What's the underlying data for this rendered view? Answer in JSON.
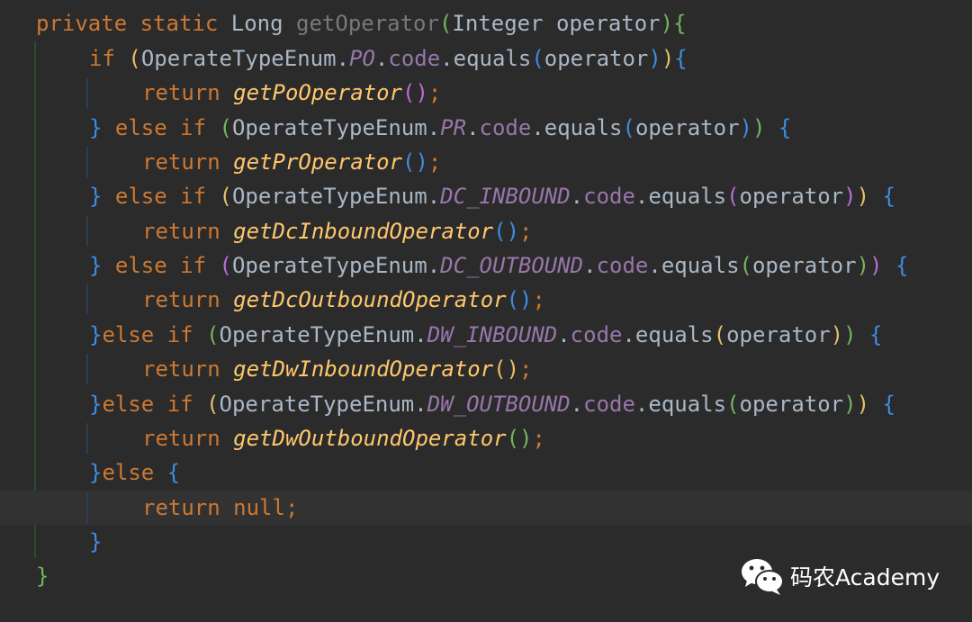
{
  "editor": {
    "theme_colors": {
      "background": "#2b2b2b",
      "current_line": "#323232",
      "keyword": "#cc7832",
      "method_declaration": "#787878",
      "identifier": "#a9b7c6",
      "static_field": "#9876aa",
      "method_call": "#ffc66d",
      "bracket_green": "#73b55e",
      "bracket_yellow": "#e8bf6a",
      "bracket_blue": "#3d8de0",
      "bracket_purple": "#b96bd6"
    },
    "current_line_index": 14,
    "lines": [
      {
        "tokens": [
          {
            "t": "private",
            "c": "kw"
          },
          {
            "t": " ",
            "c": "pun"
          },
          {
            "t": "static",
            "c": "kw"
          },
          {
            "t": " ",
            "c": "pun"
          },
          {
            "t": "Long",
            "c": "type"
          },
          {
            "t": " ",
            "c": "pun"
          },
          {
            "t": "getOperator",
            "c": "dim"
          },
          {
            "t": "(",
            "c": "b0"
          },
          {
            "t": "Integer",
            "c": "type"
          },
          {
            "t": " ",
            "c": "pun"
          },
          {
            "t": "operator",
            "c": "var"
          },
          {
            "t": ")",
            "c": "b0"
          },
          {
            "t": "{",
            "c": "b0"
          }
        ]
      },
      {
        "tokens": [
          {
            "t": "if",
            "c": "kw"
          },
          {
            "t": " ",
            "c": "pun"
          },
          {
            "t": "(",
            "c": "b1"
          },
          {
            "t": "OperateTypeEnum",
            "c": "type"
          },
          {
            "t": ".",
            "c": "pun"
          },
          {
            "t": "PO",
            "c": "fld"
          },
          {
            "t": ".",
            "c": "pun"
          },
          {
            "t": "code",
            "c": "prop"
          },
          {
            "t": ".",
            "c": "pun"
          },
          {
            "t": "equals",
            "c": "var"
          },
          {
            "t": "(",
            "c": "b2"
          },
          {
            "t": "operator",
            "c": "var"
          },
          {
            "t": ")",
            "c": "b2"
          },
          {
            "t": ")",
            "c": "b1"
          },
          {
            "t": "{",
            "c": "b2"
          }
        ]
      },
      {
        "tokens": [
          {
            "t": "return",
            "c": "kw"
          },
          {
            "t": " ",
            "c": "pun"
          },
          {
            "t": "getPoOperator",
            "c": "call"
          },
          {
            "t": "(",
            "c": "b3"
          },
          {
            "t": ")",
            "c": "b3"
          },
          {
            "t": ";",
            "c": "kw"
          }
        ]
      },
      {
        "tokens": [
          {
            "t": "}",
            "c": "b2"
          },
          {
            "t": " ",
            "c": "pun"
          },
          {
            "t": "else",
            "c": "kw"
          },
          {
            "t": " ",
            "c": "pun"
          },
          {
            "t": "if",
            "c": "kw"
          },
          {
            "t": " ",
            "c": "pun"
          },
          {
            "t": "(",
            "c": "b0"
          },
          {
            "t": "OperateTypeEnum",
            "c": "type"
          },
          {
            "t": ".",
            "c": "pun"
          },
          {
            "t": "PR",
            "c": "fld"
          },
          {
            "t": ".",
            "c": "pun"
          },
          {
            "t": "code",
            "c": "prop"
          },
          {
            "t": ".",
            "c": "pun"
          },
          {
            "t": "equals",
            "c": "var"
          },
          {
            "t": "(",
            "c": "b2"
          },
          {
            "t": "operator",
            "c": "var"
          },
          {
            "t": ")",
            "c": "b2"
          },
          {
            "t": ")",
            "c": "b0"
          },
          {
            "t": " ",
            "c": "pun"
          },
          {
            "t": "{",
            "c": "b2"
          }
        ]
      },
      {
        "tokens": [
          {
            "t": "return",
            "c": "kw"
          },
          {
            "t": " ",
            "c": "pun"
          },
          {
            "t": "getPrOperator",
            "c": "call"
          },
          {
            "t": "(",
            "c": "b2"
          },
          {
            "t": ")",
            "c": "b2"
          },
          {
            "t": ";",
            "c": "kw"
          }
        ]
      },
      {
        "tokens": [
          {
            "t": "}",
            "c": "b2"
          },
          {
            "t": " ",
            "c": "pun"
          },
          {
            "t": "else",
            "c": "kw"
          },
          {
            "t": " ",
            "c": "pun"
          },
          {
            "t": "if",
            "c": "kw"
          },
          {
            "t": " ",
            "c": "pun"
          },
          {
            "t": "(",
            "c": "b1"
          },
          {
            "t": "OperateTypeEnum",
            "c": "type"
          },
          {
            "t": ".",
            "c": "pun"
          },
          {
            "t": "DC_INBOUND",
            "c": "fld"
          },
          {
            "t": ".",
            "c": "pun"
          },
          {
            "t": "code",
            "c": "prop"
          },
          {
            "t": ".",
            "c": "pun"
          },
          {
            "t": "equals",
            "c": "var"
          },
          {
            "t": "(",
            "c": "b3"
          },
          {
            "t": "operator",
            "c": "var"
          },
          {
            "t": ")",
            "c": "b3"
          },
          {
            "t": ")",
            "c": "b1"
          },
          {
            "t": " ",
            "c": "pun"
          },
          {
            "t": "{",
            "c": "b2"
          }
        ]
      },
      {
        "tokens": [
          {
            "t": "return",
            "c": "kw"
          },
          {
            "t": " ",
            "c": "pun"
          },
          {
            "t": "getDcInboundOperator",
            "c": "call"
          },
          {
            "t": "(",
            "c": "b2"
          },
          {
            "t": ")",
            "c": "b2"
          },
          {
            "t": ";",
            "c": "kw"
          }
        ]
      },
      {
        "tokens": [
          {
            "t": "}",
            "c": "b2"
          },
          {
            "t": " ",
            "c": "pun"
          },
          {
            "t": "else",
            "c": "kw"
          },
          {
            "t": " ",
            "c": "pun"
          },
          {
            "t": "if",
            "c": "kw"
          },
          {
            "t": " ",
            "c": "pun"
          },
          {
            "t": "(",
            "c": "b3"
          },
          {
            "t": "OperateTypeEnum",
            "c": "type"
          },
          {
            "t": ".",
            "c": "pun"
          },
          {
            "t": "DC_OUTBOUND",
            "c": "fld"
          },
          {
            "t": ".",
            "c": "pun"
          },
          {
            "t": "code",
            "c": "prop"
          },
          {
            "t": ".",
            "c": "pun"
          },
          {
            "t": "equals",
            "c": "var"
          },
          {
            "t": "(",
            "c": "b0"
          },
          {
            "t": "operator",
            "c": "var"
          },
          {
            "t": ")",
            "c": "b0"
          },
          {
            "t": ")",
            "c": "b3"
          },
          {
            "t": " ",
            "c": "pun"
          },
          {
            "t": "{",
            "c": "b2"
          }
        ]
      },
      {
        "tokens": [
          {
            "t": "return",
            "c": "kw"
          },
          {
            "t": " ",
            "c": "pun"
          },
          {
            "t": "getDcOutboundOperator",
            "c": "call"
          },
          {
            "t": "(",
            "c": "b2"
          },
          {
            "t": ")",
            "c": "b2"
          },
          {
            "t": ";",
            "c": "kw"
          }
        ]
      },
      {
        "tokens": [
          {
            "t": "}",
            "c": "b2"
          },
          {
            "t": "else",
            "c": "kw"
          },
          {
            "t": " ",
            "c": "pun"
          },
          {
            "t": "if",
            "c": "kw"
          },
          {
            "t": " ",
            "c": "pun"
          },
          {
            "t": "(",
            "c": "b0"
          },
          {
            "t": "OperateTypeEnum",
            "c": "type"
          },
          {
            "t": ".",
            "c": "pun"
          },
          {
            "t": "DW_INBOUND",
            "c": "fld"
          },
          {
            "t": ".",
            "c": "pun"
          },
          {
            "t": "code",
            "c": "prop"
          },
          {
            "t": ".",
            "c": "pun"
          },
          {
            "t": "equals",
            "c": "var"
          },
          {
            "t": "(",
            "c": "b1"
          },
          {
            "t": "operator",
            "c": "var"
          },
          {
            "t": ")",
            "c": "b1"
          },
          {
            "t": ")",
            "c": "b0"
          },
          {
            "t": " ",
            "c": "pun"
          },
          {
            "t": "{",
            "c": "b2"
          }
        ]
      },
      {
        "tokens": [
          {
            "t": "return",
            "c": "kw"
          },
          {
            "t": " ",
            "c": "pun"
          },
          {
            "t": "getDwInboundOperator",
            "c": "call"
          },
          {
            "t": "(",
            "c": "b1"
          },
          {
            "t": ")",
            "c": "b1"
          },
          {
            "t": ";",
            "c": "kw"
          }
        ]
      },
      {
        "tokens": [
          {
            "t": "}",
            "c": "b2"
          },
          {
            "t": "else",
            "c": "kw"
          },
          {
            "t": " ",
            "c": "pun"
          },
          {
            "t": "if",
            "c": "kw"
          },
          {
            "t": " ",
            "c": "pun"
          },
          {
            "t": "(",
            "c": "b1"
          },
          {
            "t": "OperateTypeEnum",
            "c": "type"
          },
          {
            "t": ".",
            "c": "pun"
          },
          {
            "t": "DW_OUTBOUND",
            "c": "fld"
          },
          {
            "t": ".",
            "c": "pun"
          },
          {
            "t": "code",
            "c": "prop"
          },
          {
            "t": ".",
            "c": "pun"
          },
          {
            "t": "equals",
            "c": "var"
          },
          {
            "t": "(",
            "c": "b0"
          },
          {
            "t": "operator",
            "c": "var"
          },
          {
            "t": ")",
            "c": "b0"
          },
          {
            "t": ")",
            "c": "b1"
          },
          {
            "t": " ",
            "c": "pun"
          },
          {
            "t": "{",
            "c": "b2"
          }
        ]
      },
      {
        "tokens": [
          {
            "t": "return",
            "c": "kw"
          },
          {
            "t": " ",
            "c": "pun"
          },
          {
            "t": "getDwOutboundOperator",
            "c": "call"
          },
          {
            "t": "(",
            "c": "b0"
          },
          {
            "t": ")",
            "c": "b0"
          },
          {
            "t": ";",
            "c": "kw"
          }
        ]
      },
      {
        "tokens": [
          {
            "t": "}",
            "c": "b2"
          },
          {
            "t": "else",
            "c": "kw"
          },
          {
            "t": " ",
            "c": "pun"
          },
          {
            "t": "{",
            "c": "b2"
          }
        ]
      },
      {
        "tokens": [
          {
            "t": "return",
            "c": "kw"
          },
          {
            "t": " ",
            "c": "pun"
          },
          {
            "t": "null",
            "c": "kw"
          },
          {
            "t": ";",
            "c": "kw"
          }
        ]
      },
      {
        "tokens": [
          {
            "t": "}",
            "c": "b2"
          }
        ]
      },
      {
        "tokens": [
          {
            "t": "}",
            "c": "b0"
          }
        ]
      }
    ]
  },
  "watermark": {
    "icon": "wechat-icon",
    "text": "码农Academy"
  }
}
